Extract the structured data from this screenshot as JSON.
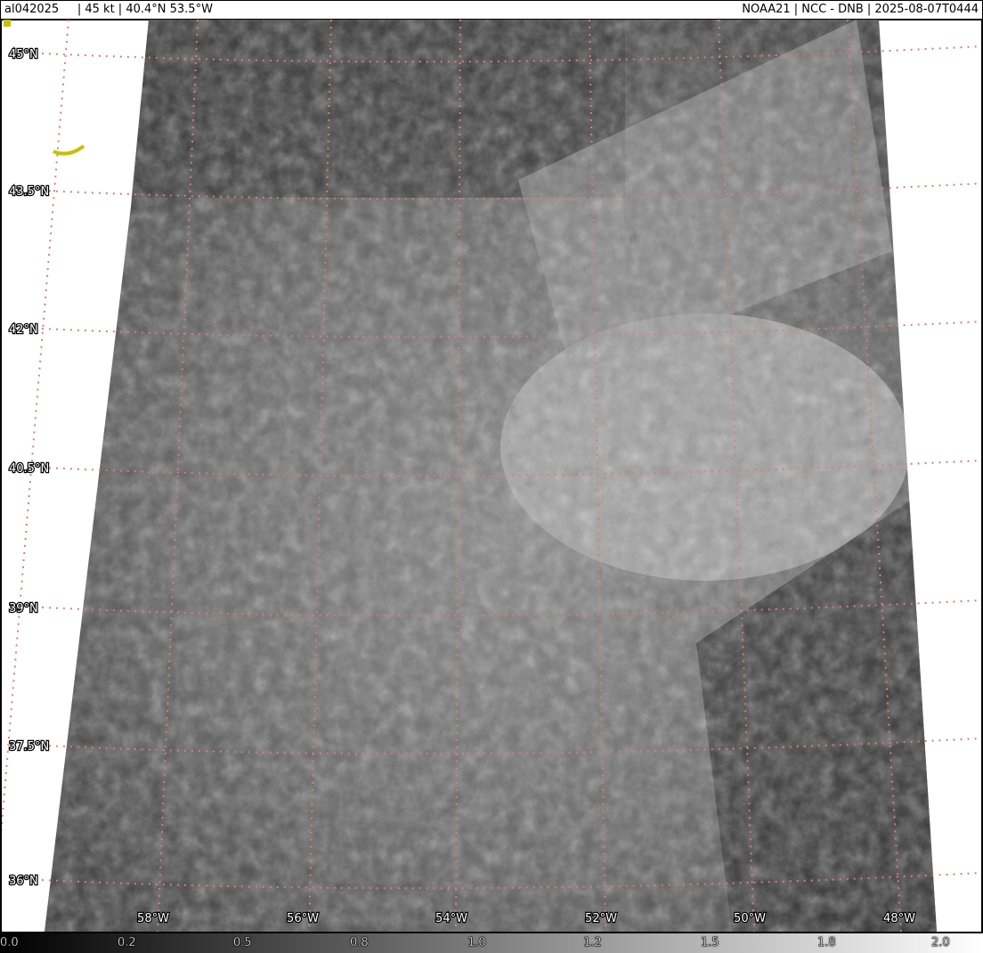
{
  "header": {
    "left": "al042025     | 45 kt | 40.4°N 53.5°W",
    "right": "NOAA21 | NCC - DNB | 2025-08-07T0444"
  },
  "map": {
    "lat_labels": [
      "45°N",
      "43.5°N",
      "42°N",
      "40.5°N",
      "39°N",
      "37.5°N",
      "36°N"
    ],
    "lon_labels": [
      "58°W",
      "56°W",
      "54°W",
      "52°W",
      "50°W",
      "48°W"
    ],
    "grid_color": "#d08080",
    "track_color": "#c8c000"
  },
  "colorbar": {
    "ticks": [
      "0.0",
      "0.2",
      "0.5",
      "0.8",
      "1.0",
      "1.2",
      "1.5",
      "1.8",
      "2.0"
    ]
  }
}
